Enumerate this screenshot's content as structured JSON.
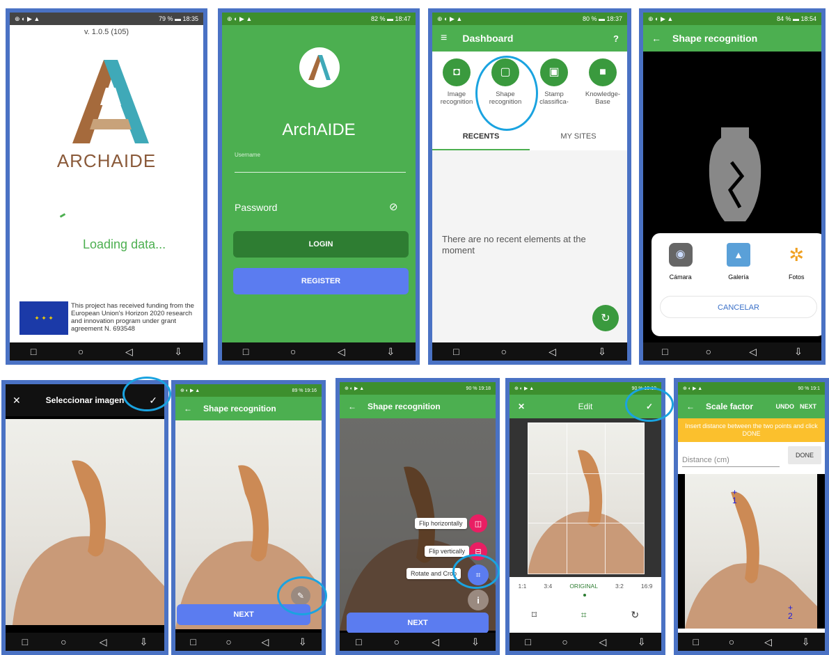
{
  "status": {
    "s1": "79 %",
    "t1": "18:35",
    "s2": "82 %",
    "t2": "18:47",
    "s3": "80 %",
    "t3": "18:37",
    "s4": "84 %",
    "t4": "18:54",
    "s6": "89 %",
    "t6": "19:16",
    "s7": "90 %",
    "t7": "19:18",
    "s8": "90 %",
    "t8": "19:18",
    "s9": "90 %",
    "t9": "19:1"
  },
  "splash": {
    "version": "v. 1.0.5 (105)",
    "brand": "ARCHAIDE",
    "loading": "Loading data...",
    "funding": "This project has received funding from the European Union's Horizon 2020 research and innovation program under grant agreement N. 693548"
  },
  "login": {
    "title": "ArchAIDE",
    "username_placeholder": "Username",
    "password_label": "Password",
    "login_label": "LOGIN",
    "register_label": "REGISTER"
  },
  "dashboard": {
    "title": "Dashboard",
    "items": [
      {
        "label": "Image recognition"
      },
      {
        "label": "Shape recognition"
      },
      {
        "label": "Stamp classifica-"
      },
      {
        "label": "Knowledge-Base"
      }
    ],
    "tabs": [
      "RECENTS",
      "MY SITES"
    ],
    "empty": "There are no recent elements at the moment"
  },
  "chooser": {
    "title": "Shape recognition",
    "options": [
      "Cámara",
      "Galería",
      "Fotos"
    ],
    "cancel": "CANCELAR"
  },
  "select": {
    "title": "Seleccionar imagen"
  },
  "shape2": {
    "title": "Shape recognition",
    "next": "NEXT"
  },
  "shape3": {
    "title": "Shape recognition",
    "next": "NEXT",
    "menu": [
      "Flip horizontally",
      "Flip vertically",
      "Rotate and Crop"
    ]
  },
  "edit": {
    "title": "Edit",
    "ratios": [
      "1:1",
      "3:4",
      "ORIGINAL",
      "3:2",
      "16:9"
    ]
  },
  "scale": {
    "title": "Scale factor",
    "undo": "UNDO",
    "next": "NEXT",
    "banner": "Insert distance between the two points and click DONE",
    "input_placeholder": "Distance (cm)",
    "done": "DONE",
    "point1": "1",
    "point2": "2"
  },
  "nav_icons": [
    "square-icon",
    "circle-icon",
    "back-icon",
    "notification-icon"
  ],
  "colors": {
    "green": "#4caf50",
    "dark_green": "#2e7d32",
    "blue": "#5b7cf0",
    "highlight": "#1aa3e0",
    "pink": "#e91e63",
    "bg_frame": "#4a72c4"
  }
}
